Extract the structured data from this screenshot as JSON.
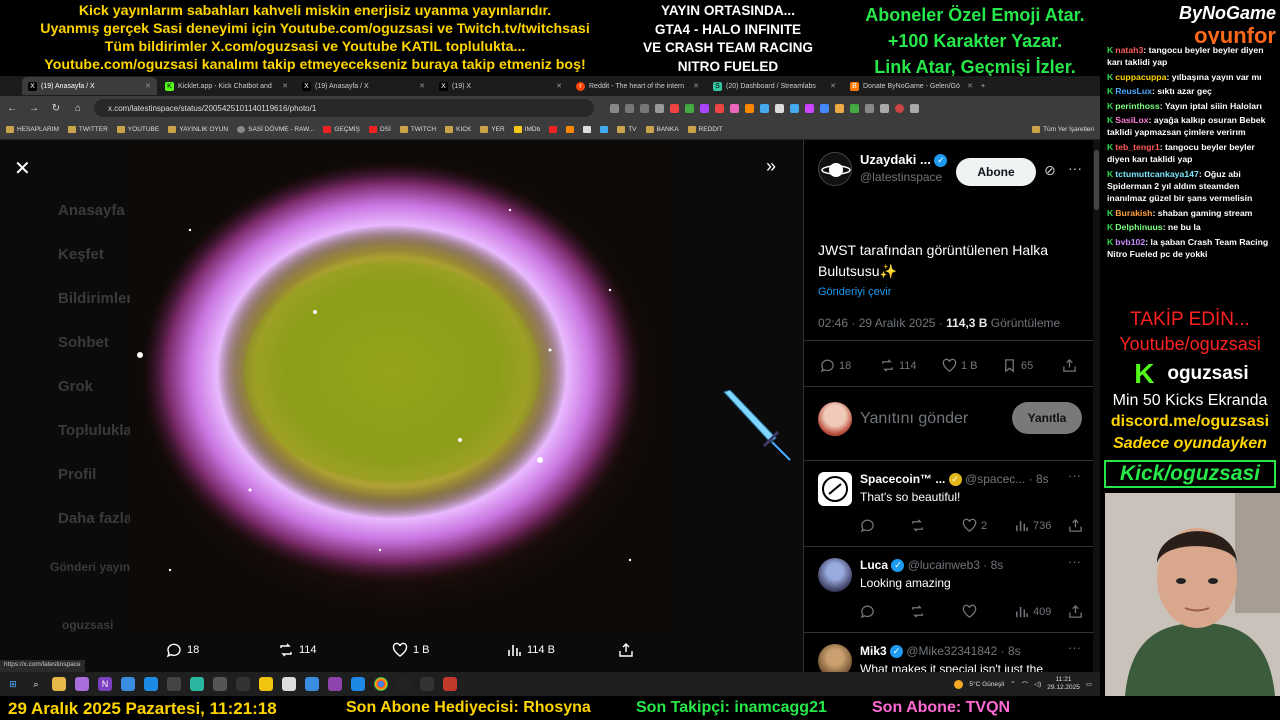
{
  "overlay": {
    "top_left_lines": [
      "Kick yayınlarım sabahları kahveli miskin enerjisiz uyanma yayınlarıdır.",
      "Uyanmış gerçek Sasi deneyimi için Youtube.com/oguzsasi ve Twitch.tv/twitchsasi",
      "Tüm bildirimler X.com/oguzsasi ve Youtube KATIL toplulukta...",
      "Youtube.com/oguzsasi kanalımı takip etmeyecekseniz buraya takip etmeniz boş!"
    ],
    "top_center_lines": [
      "YAYIN ORTASINDA...",
      "GTA4 - HALO INFINITE",
      "VE CRASH TEAM RACING",
      "NITRO FUELED"
    ],
    "top_right_lines": [
      "Aboneler Özel Emoji Atar.",
      "+100 Karakter Yazar.",
      "Link Atar, Geçmişi İzler."
    ],
    "brand_top": "ByNoGame",
    "brand_bottom": "oyunfor",
    "bottom": {
      "date_time": "29 Aralık 2025 Pazartesi, 11:21:18",
      "last_gift": "Son Abone Hediyecisi: Rhosyna",
      "last_follower": "Son Takipçi: inamcagg21",
      "last_sub": "Son Abone: TVQN"
    },
    "promo": {
      "follow": "TAKİP EDİN...",
      "youtube": "Youtube/oguzsasi",
      "kick_name": "oguzsasi",
      "kick_logo": "K",
      "min_kicks": "Min 50 Kicks Ekranda",
      "discord": "discord.me/oguzsasi",
      "only_gaming": "Sadece oyundayken",
      "kick_link": "Kick/oguzsasi"
    },
    "chat": [
      {
        "user": "natah3",
        "color": "#ff5a5a",
        "text": ": tangocu beyler beyler diyen karı taklidi yap"
      },
      {
        "user": "cuppacuppa",
        "color": "#ffd500",
        "text": ": yılbaşına yayın var mı"
      },
      {
        "user": "ReusLux",
        "color": "#4aa8ff",
        "text": ": sıktı azar geç"
      },
      {
        "user": "perinthoss",
        "color": "#7cff7c",
        "text": ": Yayın iptal siiin Haloları"
      },
      {
        "user": "SasiLox",
        "color": "#ff7ad9",
        "text": ": ayağa kalkıp osuran Bebek taklidi yapmazsan çimlere verirım"
      },
      {
        "user": "teb_tengr1",
        "color": "#ff5a5a",
        "text": ": tangocu beyler beyler diyen karı taklidi yap"
      },
      {
        "user": "tctumuttcankaya147",
        "color": "#7ce7ff",
        "text": ": Oğuz abi Spiderman 2 yıl aldım steamden inanılmaz güzel bir şans vermelisin"
      },
      {
        "user": "Burakish",
        "color": "#ffa040",
        "text": ": shaban gaming stream"
      },
      {
        "user": "Delphinuus",
        "color": "#7cff7c",
        "text": ": ne bu la"
      },
      {
        "user": "bvb102",
        "color": "#c88cff",
        "text": ": la şaban Crash Team Racing Nitro Fueled pc de yokki"
      }
    ]
  },
  "browser": {
    "tabs": [
      {
        "label": "(19) Anasayfa / X",
        "active": true,
        "fav": "X"
      },
      {
        "label": "Kicklet.app - Kick Chatbot and",
        "active": false,
        "fav": "K"
      },
      {
        "label": "(19) Anasayfa / X",
        "active": false,
        "fav": "X"
      },
      {
        "label": "(19) X",
        "active": false,
        "fav": "X"
      },
      {
        "label": "Reddit - The heart of the intern",
        "active": false,
        "fav": "r"
      },
      {
        "label": "(20) Dashboard / Streamlabs",
        "active": false,
        "fav": "S"
      },
      {
        "label": "Donate ByNoGame - Gelen/Gö",
        "active": false,
        "fav": "B"
      }
    ],
    "url": "x.com/latestinspace/status/2005425101140119616/photo/1",
    "bookmarks": [
      "HESAPLARIM",
      "TWITTER",
      "YOUTUBE",
      "YAYINLIK OYUN",
      "SASİ DÖVME - RAW...",
      "GEÇMİŞ",
      "DSİ",
      "TWITCH",
      "KICK",
      "YER",
      "IMDb",
      "TV",
      "BANKA",
      "REDDIT"
    ],
    "bookmarks_end": "Tüm Yer İşaretleri",
    "status_url": "https://x.com/latestinspace",
    "clock_time": "11:21",
    "clock_date": "29.12.2025",
    "weather": "5°C  Güneşli"
  },
  "x": {
    "ghost_nav": [
      "Anasayfa",
      "Keşfet",
      "Bildirimler",
      "Sohbet",
      "Grok",
      "Topluluklar",
      "Profil",
      "Daha fazla"
    ],
    "ghost_post": "Gönderi yayınla",
    "ghost_user": "oguzsasi",
    "photo_stats": {
      "replies": "18",
      "reposts": "114",
      "likes": "1 B",
      "views": "114 B"
    },
    "author": {
      "name": "Uzaydaki ...",
      "handle": "@latestinspace",
      "follow_label": "Abone"
    },
    "tweet_text": "JWST tarafından görüntülenen Halka Bulutsusu✨",
    "translate": "Gönderiyi çevir",
    "meta_time": "02:46 · 29 Aralık 2025 · ",
    "meta_views": "114,3 B",
    "meta_views_label": " Görüntüleme",
    "stats": {
      "replies": "18",
      "reposts": "114",
      "likes": "1 B",
      "bookmarks": "65"
    },
    "reply_placeholder": "Yanıtını gönder",
    "reply_button": "Yanıtla",
    "replies": [
      {
        "name": "Spacecoin™ ...",
        "handle": "@spacec...",
        "time": "· 8s",
        "text": "That's so beautiful!",
        "replies": "",
        "reposts": "",
        "likes": "2",
        "views": "736"
      },
      {
        "name": "Luca",
        "handle": "@lucainweb3",
        "time": "· 8s",
        "text": "Looking amazing",
        "replies": "",
        "reposts": "",
        "likes": "",
        "views": "409"
      },
      {
        "name": "Mik3",
        "handle": "@Mike32341842",
        "time": "· 8s",
        "text": "What makes it special isn't just the",
        "replies": "",
        "reposts": "",
        "likes": "",
        "views": ""
      }
    ]
  },
  "colors": {
    "accent_blue": "#1d9bf0",
    "overlay_yellow": "#ffd500",
    "overlay_green": "#27e84a",
    "overlay_red": "#ff2020"
  }
}
